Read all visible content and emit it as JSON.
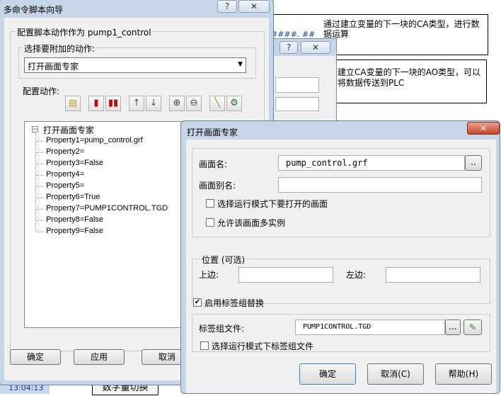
{
  "background": {
    "note1": "通过建立变量的下一块的CA类型，进行数据运算",
    "hash_text": "####. ##",
    "note2": "建立CA变量的下一块的AO类型，可以将数据传送到PLC",
    "clock": "13:04:13",
    "bottom_button": "数字量切换"
  },
  "wizard": {
    "title": "多命令脚本向导",
    "help_glyph": "?",
    "close_glyph": "✕",
    "config_label": "配置脚本动作作为 pump1_control",
    "select_action_label": "选择要附加的动作:",
    "selected_action": "打开画面专家",
    "config_actions_label": "配置动作:",
    "tree": {
      "root": "打开画面专家",
      "items": [
        "Property1=pump_control.grf",
        "Property2=",
        "Property3=False",
        "Property4=",
        "Property5=",
        "Property6=True",
        "Property7=PUMP1CONTROL.TGD",
        "Property8=False",
        "Property9=False"
      ]
    },
    "ok_label": "确定",
    "apply_label": "应用",
    "cancel_label": "取消"
  },
  "middle_dialog": {
    "help_glyph": "?",
    "close_glyph": "✕"
  },
  "expert": {
    "title": "打开画面专家",
    "close_glyph": "✕",
    "screen_name_label": "画面名:",
    "screen_name_value": "pump_control.grf",
    "browse_label": "..",
    "screen_alias_label": "画面别名:",
    "screen_alias_value": "",
    "runtime_select_label": "选择运行模式下要打开的画面",
    "runtime_select_checked": false,
    "multi_instance_label": "允许该画面多实例",
    "multi_instance_checked": false,
    "position_group_label": "位置 (可选)",
    "top_label": "上边:",
    "top_value": "",
    "left_label": "左边:",
    "left_value": "",
    "enable_tag_label": "启用标签组替换",
    "enable_tag_checked": true,
    "tag_file_label": "标签组文件:",
    "tag_file_value": "PUMP1CONTROL.TGD",
    "tag_browse_label": "...",
    "runtime_tag_label": "选择运行模式下标签组文件",
    "runtime_tag_checked": false,
    "ok_label": "确定",
    "cancel_label": "取消(C)",
    "help_label": "帮助(H)"
  },
  "icons": {
    "check": "✔",
    "dropdown": "▼",
    "toolbar": [
      "note-icon",
      "delete-icon",
      "delete-all-icon",
      "move-up-icon",
      "move-down-icon",
      "cut-icon",
      "paste-icon",
      "wand-icon",
      "settings-icon"
    ]
  },
  "colors": {
    "window_frame": "#c6d5e8",
    "dialog_face": "#f0f0f0",
    "clock_bg": "#c8d8ec",
    "clock_text": "#1a3a8a"
  }
}
